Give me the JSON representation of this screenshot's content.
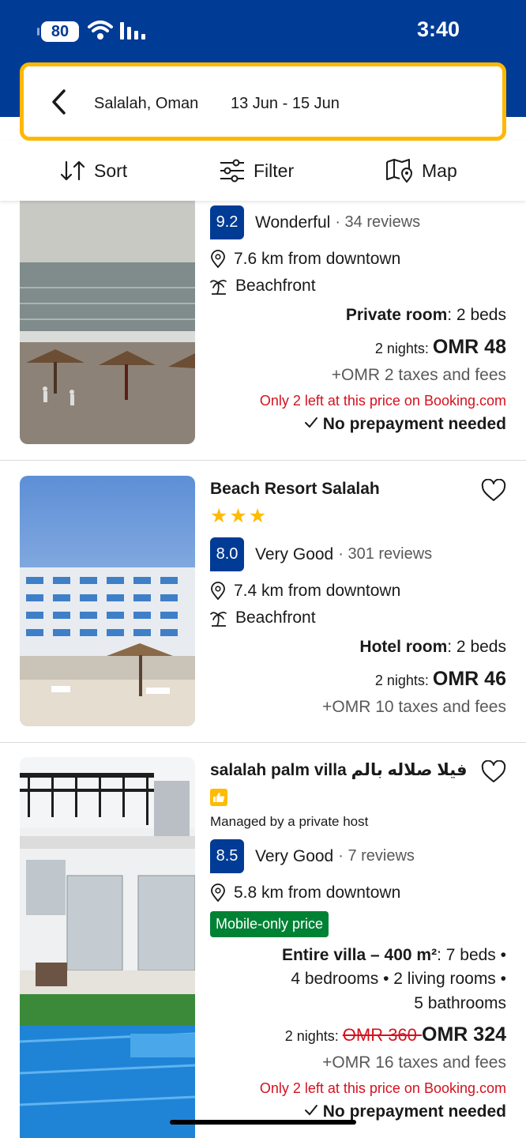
{
  "status_bar": {
    "battery": "80",
    "time": "3:40"
  },
  "search": {
    "destination": "Salalah, Oman",
    "dates": "13 Jun - 15 Jun"
  },
  "toolbar": {
    "sort_label": "Sort",
    "filter_label": "Filter",
    "map_label": "Map"
  },
  "properties": [
    {
      "score": "9.2",
      "score_label": "Wonderful",
      "reviews": "· 34 reviews",
      "distance": "7.6 km from downtown",
      "feature": "Beachfront",
      "room_type": "Private room",
      "room_details": ": 2 beds",
      "nights": "2 nights: ",
      "price": "OMR 48",
      "taxes": "+OMR 2 taxes and fees",
      "scarcity": "Only 2 left at this price on Booking.com",
      "prepayment": "No prepayment needed"
    },
    {
      "name": "Beach Resort Salalah",
      "stars": "★★★",
      "star_count": 3,
      "score": "8.0",
      "score_label": "Very Good",
      "reviews": "· 301 reviews",
      "distance": "7.4 km from downtown",
      "feature": "Beachfront",
      "room_type": "Hotel room",
      "room_details": ": 2 beds",
      "nights": "2 nights: ",
      "price": "OMR 46",
      "taxes": "+OMR 10 taxes and fees"
    },
    {
      "name": "salalah palm villa فيلا صلاله بالم",
      "managed_by": "Managed by a private host",
      "score": "8.5",
      "score_label": "Very Good",
      "reviews": "· 7 reviews",
      "distance": "5.8 km from downtown",
      "badge": "Mobile-only price",
      "room_type": "Entire villa – 400 m²",
      "room_details_1": ": 7 beds •",
      "room_details_2": "4 bedrooms • 2 living rooms •",
      "room_details_3": "5 bathrooms",
      "nights": "2 nights: ",
      "old_price": "OMR 360 ",
      "price": "OMR 324",
      "taxes": "+OMR 16 taxes and fees",
      "scarcity": "Only 2 left at this price on Booking.com",
      "prepayment": "No prepayment needed"
    }
  ],
  "colors": {
    "brand_blue": "#003b95",
    "search_border": "#ffb700",
    "star_yellow": "#febb02",
    "scarcity_red": "#d4111e",
    "deal_green": "#008234"
  },
  "icons": [
    "back-icon",
    "sort-icon",
    "filter-icon",
    "map-icon",
    "location-pin-icon",
    "palm-tree-icon",
    "heart-icon",
    "checkmark-icon",
    "thumbs-up-icon"
  ]
}
